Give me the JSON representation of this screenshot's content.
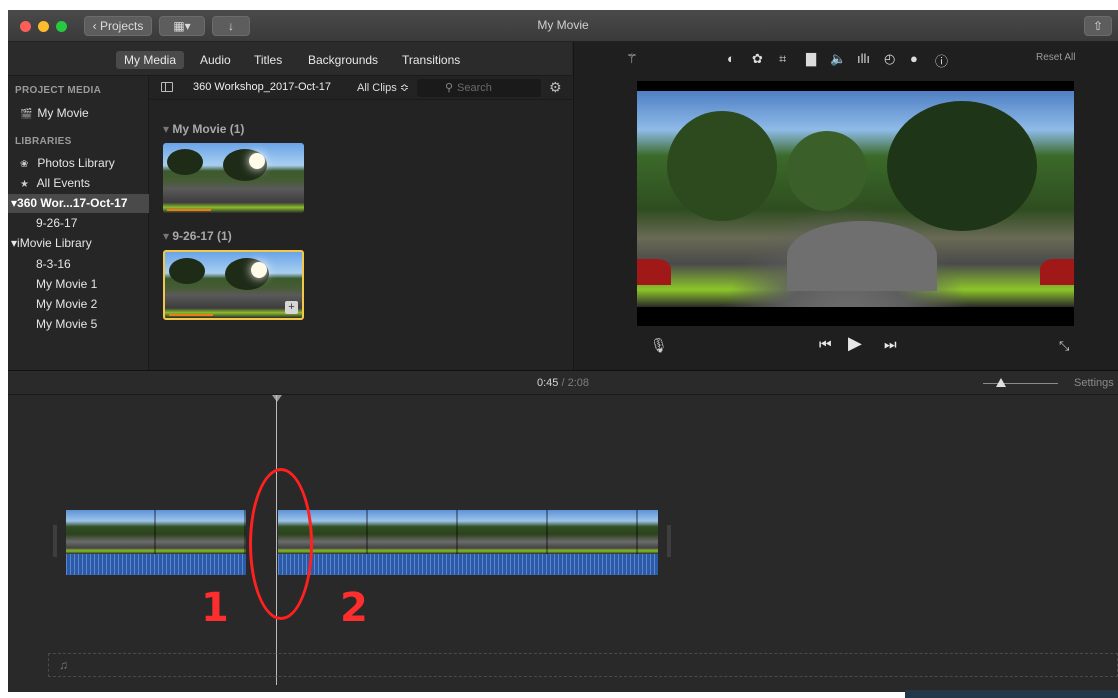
{
  "window": {
    "title": "My Movie",
    "projects_label": "Projects"
  },
  "tabs": [
    "My Media",
    "Audio",
    "Titles",
    "Backgrounds",
    "Transitions"
  ],
  "sidebar": {
    "project_media_head": "PROJECT MEDIA",
    "project_item": "My Movie",
    "libraries_head": "LIBRARIES",
    "photos_library": "Photos Library",
    "all_events": "All Events",
    "event_selected": "360 Wor...17-Oct-17",
    "event_date": "9-26-17",
    "imovie_library": "iMovie Library",
    "lib_items": [
      "8-3-16",
      "My Movie 1",
      "My Movie 2",
      "My Movie 5"
    ]
  },
  "browser": {
    "event_name": "360 Workshop_2017-Oct-17",
    "clip_filter": "All Clips ≎",
    "search_placeholder": "Search",
    "group1": "My Movie  (1)",
    "group2": "9-26-17  (1)"
  },
  "viewer": {
    "reset_all": "Reset All"
  },
  "timeline": {
    "current_time": "0:45",
    "total_time": " / 2:08",
    "settings": "Settings",
    "annotation_1": "1",
    "annotation_2": "2"
  }
}
